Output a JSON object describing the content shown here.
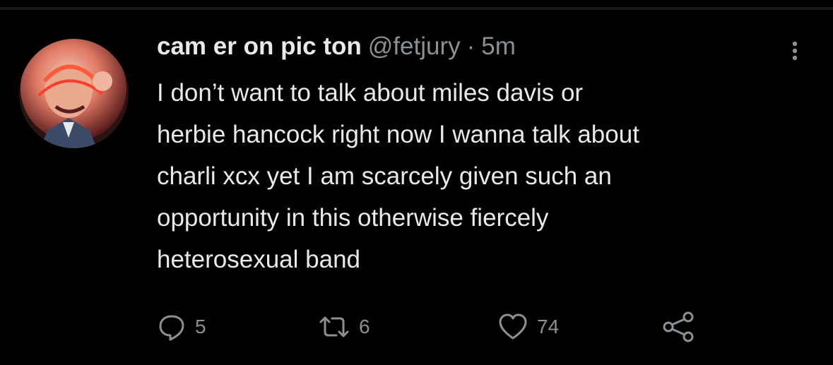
{
  "tweet": {
    "display_name": "cam er on pic ton",
    "handle": "@fetjury",
    "separator": "·",
    "time": "5m",
    "text_lines": [
      "I don’t want to talk about miles davis or",
      "herbie hancock right now I wanna talk about",
      "charli xcx yet I am scarcely given such an",
      "opportunity in this otherwise fiercely",
      "heterosexual band"
    ]
  },
  "actions": {
    "reply_count": "5",
    "retweet_count": "6",
    "like_count": "74"
  },
  "icons": {
    "avatar": "avatar",
    "more": "more-vertical-icon",
    "reply": "reply-icon",
    "retweet": "retweet-icon",
    "like": "heart-icon",
    "share": "share-icon"
  },
  "colors": {
    "background": "#000000",
    "text_primary": "#e7e9ea",
    "text_secondary": "#8b9095"
  }
}
